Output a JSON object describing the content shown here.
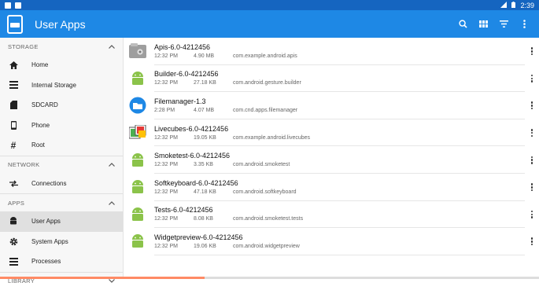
{
  "status": {
    "time": "2:39"
  },
  "toolbar": {
    "title": "User Apps",
    "icons": [
      "search-icon",
      "grid-view-icon",
      "filter-icon",
      "more-vert-icon"
    ]
  },
  "sidebar": {
    "sections": [
      {
        "title": "STORAGE",
        "items": [
          {
            "label": "Home",
            "icon": "home-icon"
          },
          {
            "label": "Internal Storage",
            "icon": "storage-icon"
          },
          {
            "label": "SDCARD",
            "icon": "sdcard-icon"
          },
          {
            "label": "Phone",
            "icon": "phone-icon"
          },
          {
            "label": "Root",
            "icon": "hash-icon"
          }
        ]
      },
      {
        "title": "NETWORK",
        "items": [
          {
            "label": "Connections",
            "icon": "connections-icon"
          }
        ]
      },
      {
        "title": "APPS",
        "items": [
          {
            "label": "User Apps",
            "icon": "android-icon",
            "selected": true
          },
          {
            "label": "System Apps",
            "icon": "gear-icon"
          },
          {
            "label": "Processes",
            "icon": "list-icon"
          }
        ]
      },
      {
        "title": "LIBRARY",
        "items": []
      }
    ]
  },
  "apps": [
    {
      "name": "Apis-6.0-4212456",
      "time": "12:32 PM",
      "size": "4.90 MB",
      "package": "com.example.android.apis",
      "icon": "apis-icon"
    },
    {
      "name": "Builder-6.0-4212456",
      "time": "12:32 PM",
      "size": "27.18 KB",
      "package": "com.android.gesture.builder",
      "icon": "android-icon"
    },
    {
      "name": "Filemanager-1.3",
      "time": "2:28 PM",
      "size": "4.07 MB",
      "package": "com.cnd.apps.filemanager",
      "icon": "filemanager-icon"
    },
    {
      "name": "Livecubes-6.0-4212456",
      "time": "12:32 PM",
      "size": "19.05 KB",
      "package": "com.example.android.livecubes",
      "icon": "livecubes-icon"
    },
    {
      "name": "Smoketest-6.0-4212456",
      "time": "12:32 PM",
      "size": "3.35 KB",
      "package": "com.android.smoketest",
      "icon": "android-icon"
    },
    {
      "name": "Softkeyboard-6.0-4212456",
      "time": "12:32 PM",
      "size": "47.18 KB",
      "package": "com.android.softkeyboard",
      "icon": "android-icon"
    },
    {
      "name": "Tests-6.0-4212456",
      "time": "12:32 PM",
      "size": "8.08 KB",
      "package": "com.android.smoketest.tests",
      "icon": "android-icon"
    },
    {
      "name": "Widgetpreview-6.0-4212456",
      "time": "12:32 PM",
      "size": "19.06 KB",
      "package": "com.android.widgetpreview",
      "icon": "android-icon"
    }
  ],
  "colors": {
    "statusbar": "#1565c0",
    "toolbar": "#1e88e5",
    "android_green": "#8bc34a",
    "selected_bg": "#e0e0e0"
  }
}
